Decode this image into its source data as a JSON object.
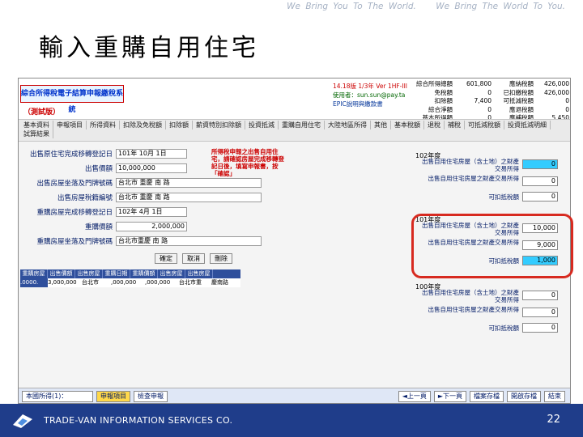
{
  "slide": {
    "slogan_1": "We Bring You To The World.",
    "slogan_2": "We Bring The World To You.",
    "title": "輸入重購自用住宅",
    "company": "TRADE-VAN INFORMATION SERVICES CO.",
    "page_number": "22"
  },
  "app": {
    "brand": "綜合所得稅電子結算申報繳稅系統",
    "brand_sub": "（測試版）",
    "user_lines": [
      "14.18版 1/3年 Ver 1HF-III",
      "使用者：sun.sun@pay.ta",
      "EPIC說明與繳款書"
    ],
    "stats_a": [
      {
        "label": "綜合所得總額",
        "value": "601,800"
      },
      {
        "label": "免稅額",
        "value": "0"
      },
      {
        "label": "扣除額",
        "value": "7,400"
      },
      {
        "label": "綜合淨額",
        "value": "0"
      },
      {
        "label": "基本所得額",
        "value": "0"
      }
    ],
    "stats_b": [
      {
        "label": "應納稅額",
        "value": "426,000"
      },
      {
        "label": "已扣繳稅額",
        "value": "426,000"
      },
      {
        "label": "可抵減稅額",
        "value": "0"
      },
      {
        "label": "應退稅額",
        "value": "0"
      },
      {
        "label": "應補稅額",
        "value": "5,450"
      }
    ],
    "tabs": [
      "基本資料",
      "申報項目",
      "所得資料",
      "扣除及免稅額",
      "扣除額",
      "薪資特別扣除額",
      "投資抵減",
      "重購自用住宅",
      "大陸地區所得",
      "其他",
      "基本稅額",
      "退稅",
      "補稅",
      "可抵減稅額",
      "投資抵減明細",
      "試算結果"
    ],
    "form": {
      "rows": [
        {
          "label": "出售原住宅完成移轉登記日",
          "value": "101年 10月 1日"
        },
        {
          "label": "出售價額",
          "value": "10,000,000"
        },
        {
          "label": "出售房屋坐落及門牌號碼",
          "value": "台北市 重慶 南 路"
        },
        {
          "label": "出售房屋稅籍編號",
          "value": "台北市 重慶 南 路"
        },
        {
          "label": "重購房屋完成移轉登記日",
          "value": "102年 4月 1日"
        },
        {
          "label": "重購價額",
          "value": "2,000,000"
        },
        {
          "label": "重購房屋坐落及門牌號碼",
          "value": "台北市重慶 南 路"
        }
      ],
      "note": "所得稅申報之出售自用住宅，請確認房屋完成移轉登記日後，填寫申報書，按「確認」",
      "buttons": [
        "確定",
        "取消",
        "刪除"
      ]
    },
    "grid": {
      "headers": [
        "重購房屋",
        "出售價額",
        "出售房屋",
        "重購日期",
        "重購價額",
        "出售房屋",
        "出售房屋"
      ],
      "row": [
        ".0000.",
        "3,000,000",
        "台北市",
        ",000,000",
        ",000,000",
        "台北市重",
        "慶南路"
      ]
    },
    "panels": [
      {
        "year": "102年度",
        "lines": [
          {
            "label": "出售自用住宅房屋（含土地）之財產交易所得",
            "value": "0",
            "cyan": true
          },
          {
            "label": "出售自用住宅房屋之財產交易所得",
            "value": "0",
            "cyan": false
          },
          {
            "label": "可扣抵稅額",
            "value": "0",
            "cyan": false
          }
        ]
      },
      {
        "year": "101年度",
        "lines": [
          {
            "label": "出售自用住宅房屋（含土地）之財產交易所得",
            "value": "10,000",
            "cyan": false
          },
          {
            "label": "出售自用住宅房屋之財產交易所得",
            "value": "9,000",
            "cyan": false
          },
          {
            "label": "可扣抵稅額",
            "value": "1,000",
            "cyan": true
          }
        ]
      },
      {
        "year": "100年度",
        "lines": [
          {
            "label": "出售自用住宅房屋（含土地）之財產交易所得",
            "value": "0",
            "cyan": false
          },
          {
            "label": "出售自用住宅房屋之財產交易所得",
            "value": "0",
            "cyan": false
          },
          {
            "label": "可扣抵稅額",
            "value": "0",
            "cyan": false
          }
        ]
      }
    ],
    "status": {
      "left": "本國所得(1)：",
      "mid": [
        "申報項目",
        "檢查申報"
      ],
      "right": [
        "◄上一頁",
        "►下一頁",
        "檔案存檔",
        "開啟存檔",
        "結束"
      ]
    }
  }
}
